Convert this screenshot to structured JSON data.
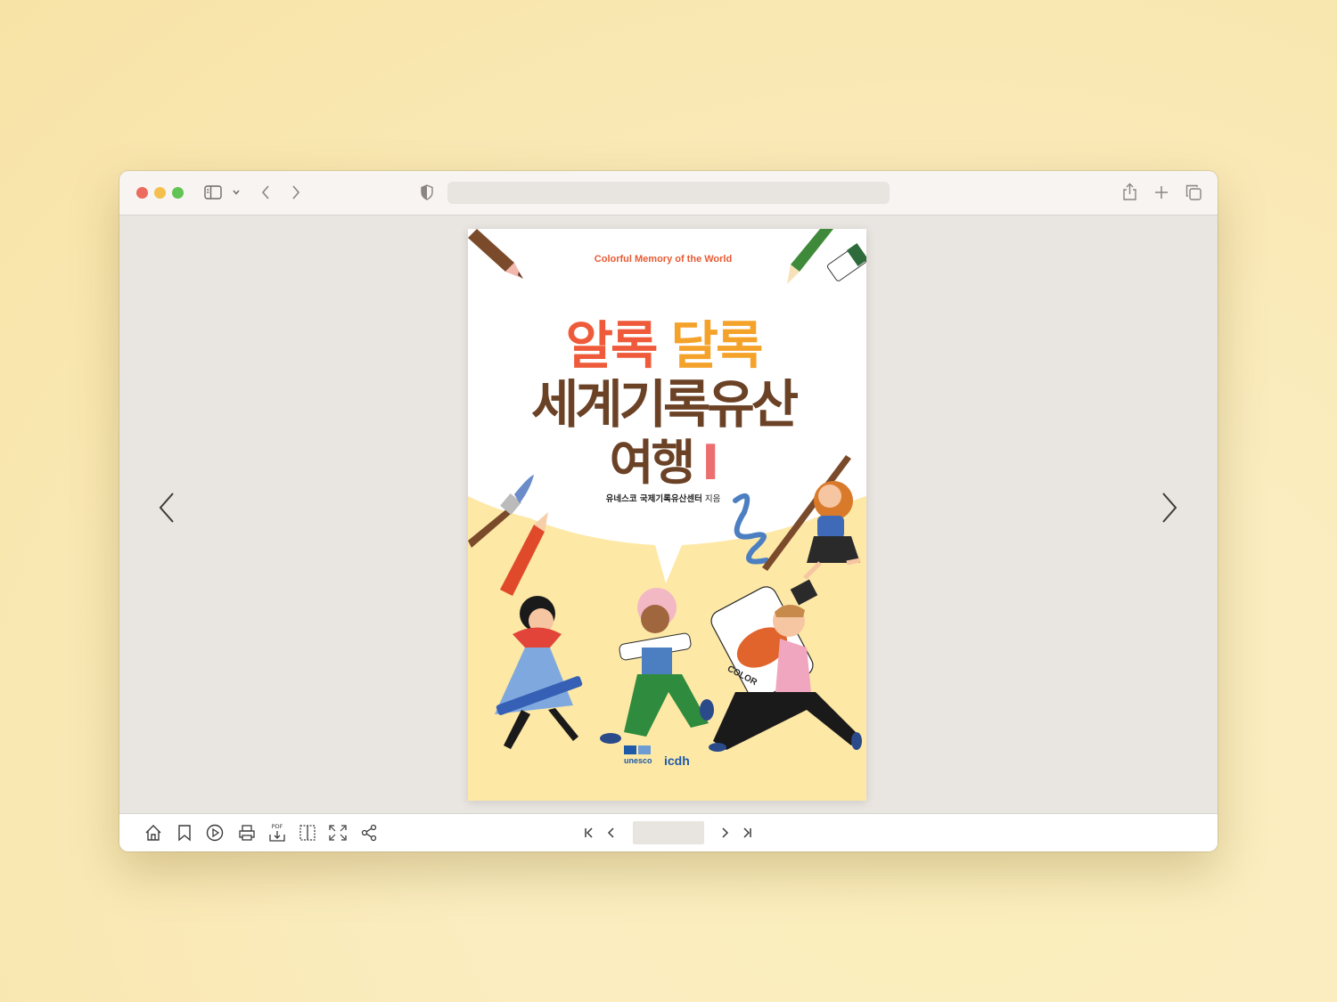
{
  "browser": {
    "address_value": "",
    "traffic_lights": [
      "#ec6a5e",
      "#f4bf4f",
      "#61c454"
    ],
    "toolbar_icons": [
      "sidebar-icon",
      "chevron-down-icon",
      "back-icon",
      "forward-icon",
      "privacy-shield-icon",
      "share-icon",
      "new-tab-icon",
      "tabs-overview-icon"
    ]
  },
  "cover": {
    "english_title": "Colorful Memory of the World",
    "title_part1": "알록",
    "title_part2": "달록",
    "title_line2": "세계기록유산",
    "title_line3": "여행",
    "volume": "I",
    "author_bold": "유네스코 국제기록유산센터",
    "author_suffix": " 지음",
    "badge_color": "COLOR",
    "publisher_logo_1": "unesco",
    "publisher_logo_2": "icdh",
    "colors": {
      "brown": "#6b4226",
      "orange": "#ee5a3a",
      "green": "#8cc63f",
      "yellow_bg": "#fde8a6"
    }
  },
  "viewer_toolbar": {
    "icons": [
      "home-icon",
      "bookmark-icon",
      "play-icon",
      "print-icon",
      "pdf-download-icon",
      "two-page-view-icon",
      "fullscreen-icon",
      "share-icon"
    ],
    "pdf_label": "PDF",
    "page_input_value": "",
    "pager_icons": [
      "first-page-icon",
      "prev-page-icon",
      "next-page-icon",
      "last-page-icon"
    ]
  }
}
